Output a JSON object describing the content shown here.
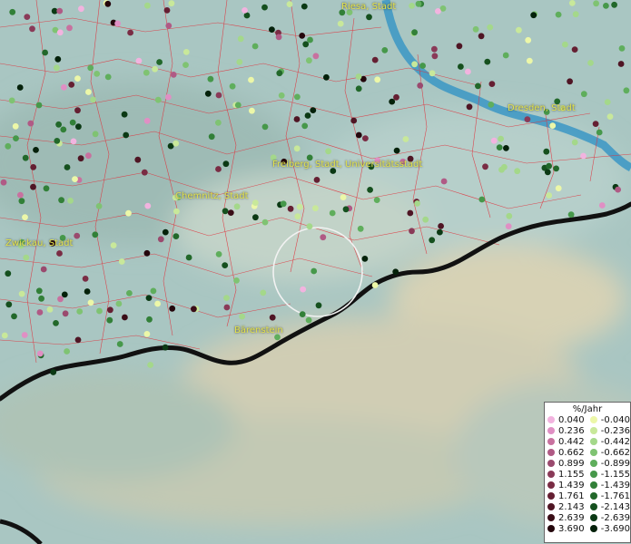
{
  "cities": [
    {
      "name": "Riesa, Stadt",
      "key": "riesa"
    },
    {
      "name": "Dresden, Stadt",
      "key": "dresden"
    },
    {
      "name": "Freiberg, Stadt, Universitätsstadt",
      "key": "freiberg"
    },
    {
      "name": "Chemnitz, Stadt",
      "key": "chemnitz"
    },
    {
      "name": "Zwickau, Stadt",
      "key": "zwickau"
    },
    {
      "name": "Bärenstein",
      "key": "baerenstein"
    }
  ],
  "legend": {
    "title": "%/Jahr",
    "positive": [
      {
        "label": "0.040",
        "color": "#f2b3df"
      },
      {
        "label": "0.236",
        "color": "#e08fc4"
      },
      {
        "label": "0.442",
        "color": "#c8719f"
      },
      {
        "label": "0.662",
        "color": "#b05a85"
      },
      {
        "label": "0.899",
        "color": "#9a4a6e"
      },
      {
        "label": "1.155",
        "color": "#8a3a58"
      },
      {
        "label": "1.439",
        "color": "#7a2c44"
      },
      {
        "label": "1.761",
        "color": "#651f32"
      },
      {
        "label": "2.143",
        "color": "#4f1524"
      },
      {
        "label": "2.639",
        "color": "#3a0d17"
      },
      {
        "label": "3.690",
        "color": "#24060c"
      }
    ],
    "negative": [
      {
        "label": "-0.040",
        "color": "#ecf7a8"
      },
      {
        "label": "-0.236",
        "color": "#c8e89a"
      },
      {
        "label": "-0.442",
        "color": "#a4d88a"
      },
      {
        "label": "-0.662",
        "color": "#7fc372"
      },
      {
        "label": "-0.899",
        "color": "#5fae5c"
      },
      {
        "label": "-1.155",
        "color": "#46984a"
      },
      {
        "label": "-1.439",
        "color": "#328038"
      },
      {
        "label": "-1.761",
        "color": "#22682a"
      },
      {
        "label": "-2.143",
        "color": "#15501e"
      },
      {
        "label": "-2.639",
        "color": "#0b3914"
      },
      {
        "label": "-3.690",
        "color": "#04210a"
      }
    ]
  },
  "colors": {
    "water": "#3b97c4",
    "boundaries": "#e0303a",
    "border": "#111111",
    "city_label": "#e3e34a"
  }
}
